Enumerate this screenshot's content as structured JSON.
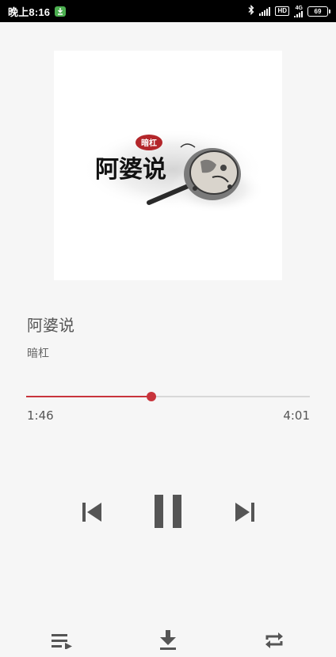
{
  "status_bar": {
    "time": "晚上8:16",
    "download_icon": "download-notification-icon",
    "bluetooth_icon": "bluetooth-icon",
    "hd_badge": "HD",
    "network": "4G",
    "battery_level": "69"
  },
  "cover": {
    "title": "阿婆说",
    "seal_text": "暗杠"
  },
  "track": {
    "title": "阿婆说",
    "artist": "暗杠"
  },
  "playback": {
    "current_time": "1:46",
    "total_time": "4:01",
    "progress": 0.44
  },
  "colors": {
    "accent": "#c8343c",
    "icon": "#555555",
    "background": "#f6f6f6"
  },
  "controls": {
    "previous_icon": "skip-previous-icon",
    "pause_icon": "pause-icon",
    "next_icon": "skip-next-icon",
    "playlist_icon": "playlist-icon",
    "download_icon": "download-icon",
    "repeat_icon": "repeat-icon"
  }
}
